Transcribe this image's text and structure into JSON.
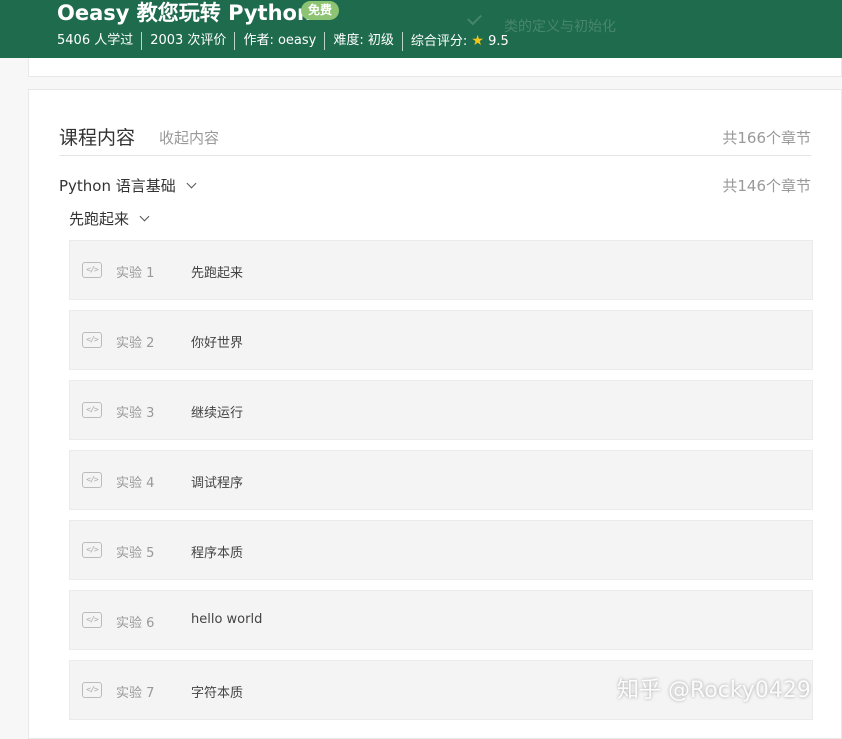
{
  "header": {
    "title": "Oeasy 教您玩转 Python",
    "badge": "免费",
    "ghost_text": "类的定义与初始化",
    "meta": {
      "learners": "5406 人学过",
      "reviews": "2003 次评价",
      "author": "作者: oeasy",
      "difficulty": "难度: 初级",
      "rating_label": "综合评分:",
      "rating_icon": "star-icon",
      "rating_value": "9.5"
    }
  },
  "course_content": {
    "title": "课程内容",
    "collapse_label": "收起内容",
    "total": "共166个章节",
    "section": {
      "title": "Python 语言基础",
      "count": "共146个章节",
      "subsection": {
        "title": "先跑起来",
        "lessons": [
          {
            "num": "实验 1",
            "name": "先跑起来"
          },
          {
            "num": "实验 2",
            "name": "你好世界"
          },
          {
            "num": "实验 3",
            "name": "继续运行"
          },
          {
            "num": "实验 4",
            "name": "调试程序"
          },
          {
            "num": "实验 5",
            "name": "程序本质"
          },
          {
            "num": "实验 6",
            "name": "hello world"
          },
          {
            "num": "实验 7",
            "name": "字符本质"
          }
        ]
      }
    }
  },
  "watermark": "知乎 @Rocky0429",
  "colors": {
    "header_bg": "#1f6b4e",
    "badge_bg": "#8dc473",
    "star": "#f5c518"
  }
}
